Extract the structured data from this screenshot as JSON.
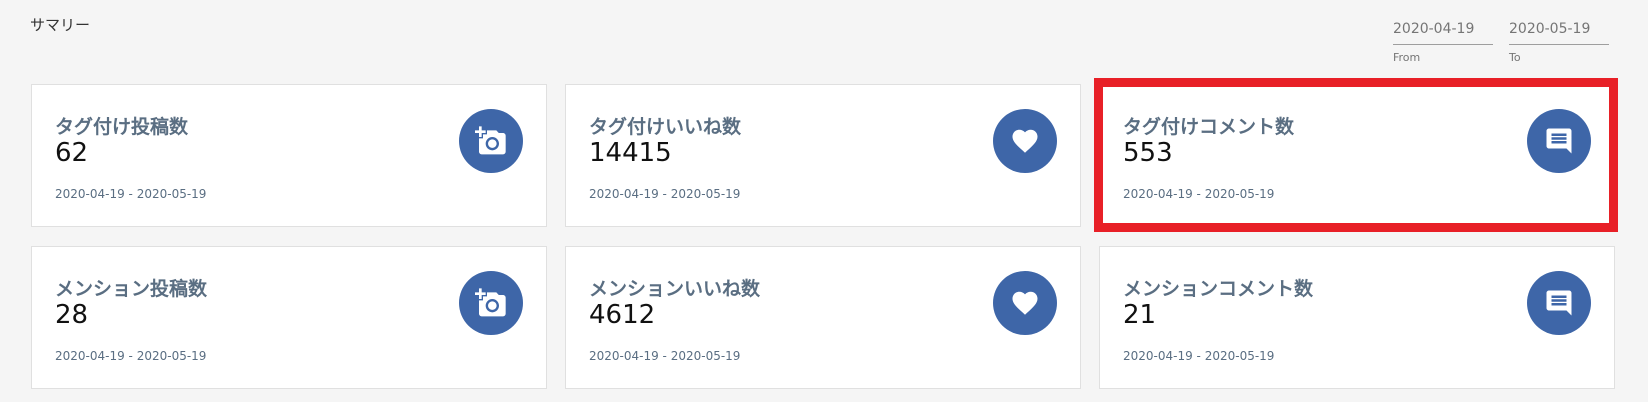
{
  "header": {
    "title": "サマリー"
  },
  "date_range": {
    "from_value": "2020-04-19",
    "from_label": "From",
    "to_value": "2020-05-19",
    "to_label": "To"
  },
  "cards": [
    {
      "title": "タグ付け投稿数",
      "value": "62",
      "range": "2020-04-19 - 2020-05-19",
      "icon": "add-photo-icon"
    },
    {
      "title": "タグ付けいいね数",
      "value": "14415",
      "range": "2020-04-19 - 2020-05-19",
      "icon": "heart-icon"
    },
    {
      "title": "タグ付けコメント数",
      "value": "553",
      "range": "2020-04-19 - 2020-05-19",
      "icon": "comment-icon"
    },
    {
      "title": "メンション投稿数",
      "value": "28",
      "range": "2020-04-19 - 2020-05-19",
      "icon": "add-photo-icon"
    },
    {
      "title": "メンションいいね数",
      "value": "4612",
      "range": "2020-04-19 - 2020-05-19",
      "icon": "heart-icon"
    },
    {
      "title": "メンションコメント数",
      "value": "21",
      "range": "2020-04-19 - 2020-05-19",
      "icon": "comment-icon"
    }
  ],
  "colors": {
    "icon_background": "#3e66a8",
    "highlight": "#e82027",
    "card_title": "#5a6e82"
  }
}
